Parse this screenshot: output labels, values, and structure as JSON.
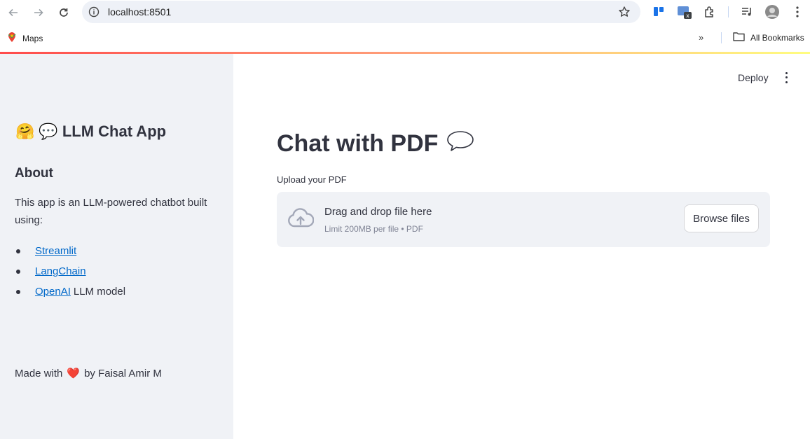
{
  "browser": {
    "url": "localhost:8501",
    "bookmarks": {
      "maps_label": "Maps",
      "all_bookmarks_label": "All Bookmarks",
      "overflow_label": "»"
    },
    "icons": [
      "back-arrow-icon",
      "forward-arrow-icon",
      "reload-icon",
      "site-info-icon",
      "bookmark-star-icon",
      "extension-icon",
      "puzzle-icon",
      "media-control-icon",
      "profile-avatar",
      "chrome-menu-icon",
      "folder-icon",
      "maps-pin-icon"
    ],
    "decoration_colors": [
      "#ff4b4b",
      "#ffa07a",
      "#fffd80"
    ]
  },
  "sidebar": {
    "title_emoji_1": "🤗",
    "title_emoji_2": "💬",
    "title": "LLM Chat App",
    "about_heading": "About",
    "description": "This app is an LLM-powered chatbot built using:",
    "links": [
      {
        "link_text": "Streamlit",
        "rest": ""
      },
      {
        "link_text": "LangChain",
        "rest": ""
      },
      {
        "link_text": "OpenAI",
        "rest": "LLM model"
      }
    ],
    "footer_prefix": "Made with",
    "footer_emoji": "❤️",
    "footer_suffix": "by Faisal Amir M"
  },
  "main": {
    "deploy_label": "Deploy",
    "title": "Chat with PDF",
    "title_emoji": "💬",
    "uploader": {
      "label": "Upload your PDF",
      "drop_text": "Drag and drop file here",
      "limit_text": "Limit 200MB per file • PDF",
      "browse_label": "Browse files"
    }
  },
  "colors": {
    "sidebar_bg": "#f0f2f6",
    "text": "#31333f",
    "link": "#0068c9",
    "muted": "#808495"
  }
}
